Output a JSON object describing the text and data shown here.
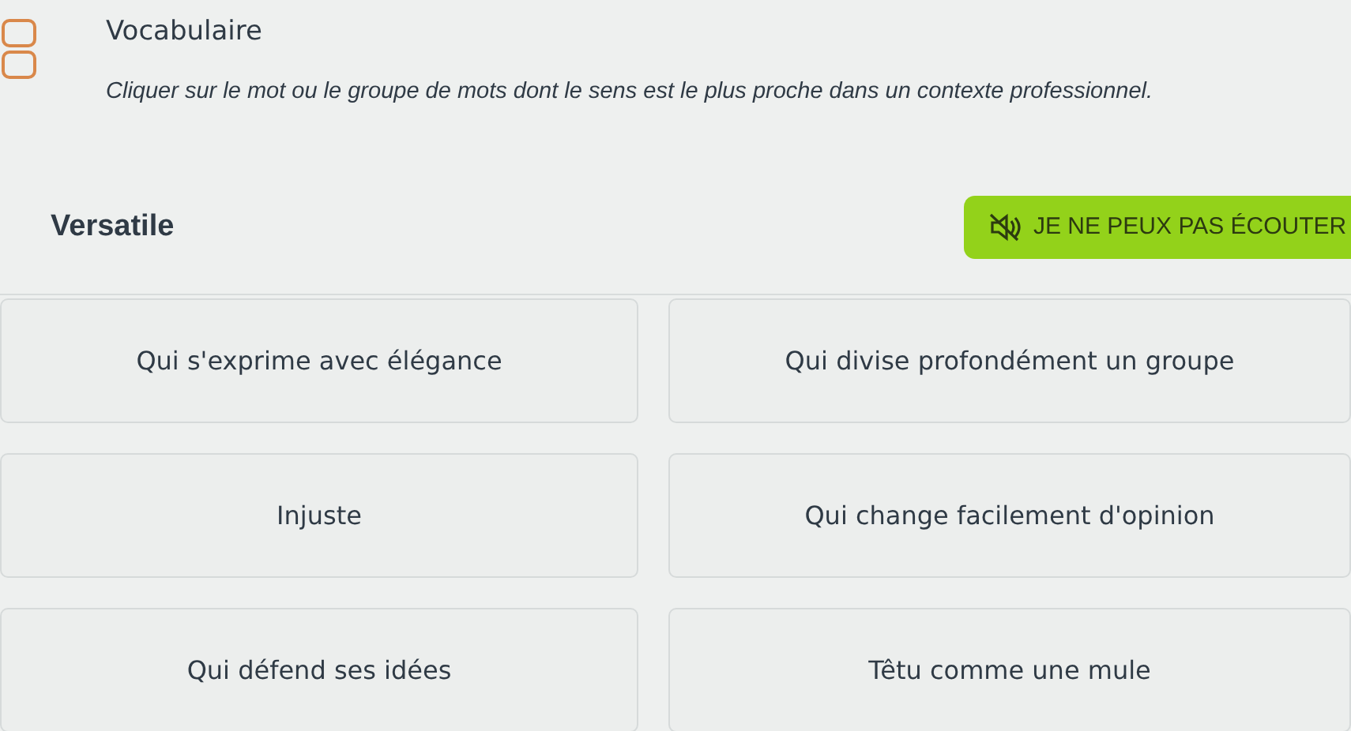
{
  "header": {
    "title": "Vocabulaire",
    "instruction": "Cliquer sur le mot ou le groupe de mots dont le sens est le plus proche dans un contexte professionnel."
  },
  "question": {
    "word": "Versatile"
  },
  "listen_button": {
    "label": "JE NE PEUX PAS ÉCOUTER"
  },
  "options": [
    {
      "label": "Qui s'exprime avec élégance",
      "selected": false
    },
    {
      "label": "Qui divise profondément un groupe",
      "selected": false
    },
    {
      "label": "Injuste",
      "selected": false
    },
    {
      "label": "Qui change facilement d'opinion",
      "selected": false
    },
    {
      "label": "Qui défend ses idées",
      "selected": false
    },
    {
      "label": "Têtu comme une mule",
      "selected": false
    }
  ]
}
